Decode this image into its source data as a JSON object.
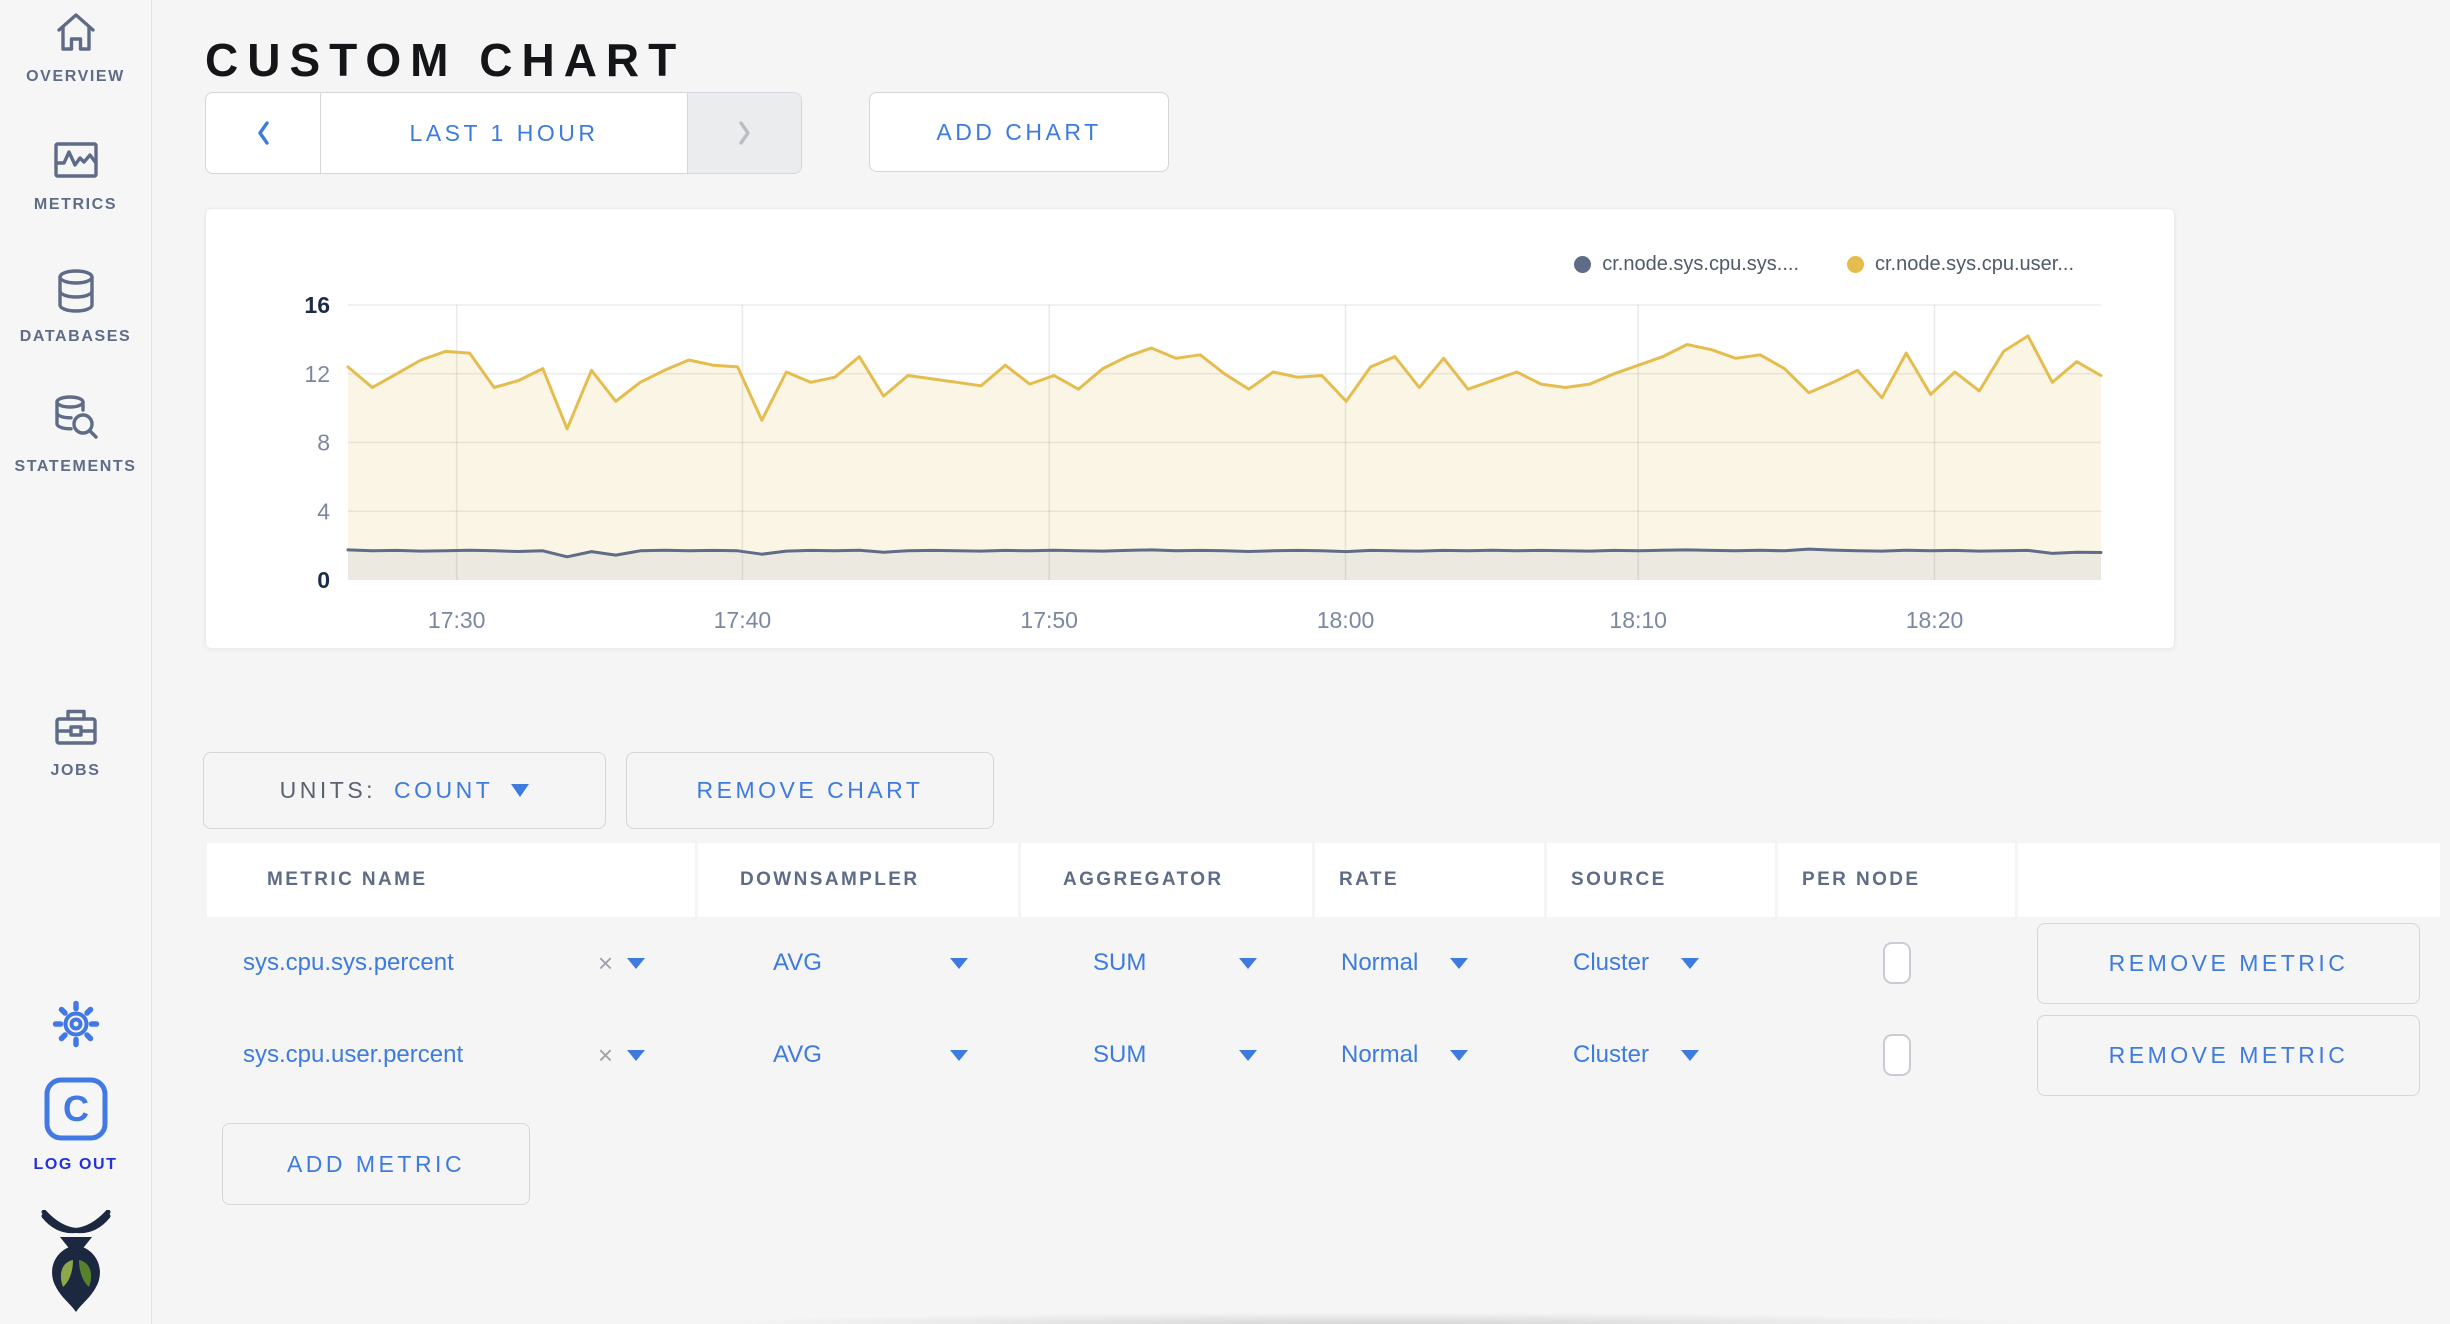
{
  "header": {
    "title": "CUSTOM CHART"
  },
  "sidebar": {
    "items": [
      {
        "label": "OVERVIEW",
        "icon": "home-icon"
      },
      {
        "label": "METRICS",
        "icon": "metrics-icon"
      },
      {
        "label": "DATABASES",
        "icon": "database-icon"
      },
      {
        "label": "STATEMENTS",
        "icon": "statements-icon"
      },
      {
        "label": "JOBS",
        "icon": "briefcase-icon"
      }
    ],
    "logout_label": "LOG OUT"
  },
  "controls": {
    "time_range_label": "LAST 1 HOUR",
    "add_chart_label": "ADD CHART"
  },
  "units": {
    "label": "UNITS:",
    "value": "COUNT"
  },
  "remove_chart_label": "REMOVE CHART",
  "add_metric_label": "ADD METRIC",
  "metrics_table": {
    "columns": [
      "METRIC NAME",
      "DOWNSAMPLER",
      "AGGREGATOR",
      "RATE",
      "SOURCE",
      "PER NODE",
      ""
    ],
    "clear_glyph": "×",
    "rows": [
      {
        "metric": "sys.cpu.sys.percent",
        "downsampler": "AVG",
        "aggregator": "SUM",
        "rate": "Normal",
        "source": "Cluster",
        "per_node": false,
        "remove_label": "REMOVE METRIC"
      },
      {
        "metric": "sys.cpu.user.percent",
        "downsampler": "AVG",
        "aggregator": "SUM",
        "rate": "Normal",
        "source": "Cluster",
        "per_node": false,
        "remove_label": "REMOVE METRIC"
      }
    ]
  },
  "chart_data": {
    "type": "line",
    "title": "",
    "xlabel": "",
    "ylabel": "",
    "ylim": [
      0,
      16
    ],
    "y_ticks": [
      0,
      4,
      8,
      12,
      16
    ],
    "grid": true,
    "legend_position": "top-right",
    "x_ticks": [
      {
        "label": "17:30",
        "frac": 0.062
      },
      {
        "label": "17:40",
        "frac": 0.225
      },
      {
        "label": "17:50",
        "frac": 0.4
      },
      {
        "label": "18:00",
        "frac": 0.569
      },
      {
        "label": "18:10",
        "frac": 0.736
      },
      {
        "label": "18:20",
        "frac": 0.905
      }
    ],
    "x_range_minutes": [
      "17:26",
      "18:26"
    ],
    "series": [
      {
        "name": "cr.node.sys.cpu.sys....",
        "color": "#5f6c87",
        "fill": "#ece9e0",
        "values": [
          1.75,
          1.7,
          1.72,
          1.68,
          1.7,
          1.73,
          1.7,
          1.66,
          1.7,
          1.35,
          1.65,
          1.45,
          1.7,
          1.73,
          1.7,
          1.72,
          1.7,
          1.5,
          1.68,
          1.72,
          1.7,
          1.73,
          1.62,
          1.7,
          1.72,
          1.7,
          1.68,
          1.72,
          1.7,
          1.73,
          1.7,
          1.68,
          1.72,
          1.75,
          1.7,
          1.72,
          1.7,
          1.66,
          1.7,
          1.72,
          1.7,
          1.65,
          1.72,
          1.7,
          1.68,
          1.72,
          1.7,
          1.73,
          1.7,
          1.72,
          1.7,
          1.68,
          1.72,
          1.7,
          1.73,
          1.75,
          1.72,
          1.7,
          1.73,
          1.7,
          1.8,
          1.74,
          1.7,
          1.68,
          1.73,
          1.7,
          1.72,
          1.68,
          1.7,
          1.72,
          1.55,
          1.62,
          1.6
        ]
      },
      {
        "name": "cr.node.sys.cpu.user...",
        "color": "#e5bd4f",
        "fill": "#faf5e5",
        "values": [
          12.4,
          11.2,
          12.0,
          12.8,
          13.3,
          13.2,
          11.2,
          11.6,
          12.3,
          8.8,
          12.2,
          10.4,
          11.5,
          12.2,
          12.8,
          12.5,
          12.4,
          9.3,
          12.1,
          11.5,
          11.8,
          13.0,
          10.7,
          11.9,
          11.7,
          11.5,
          11.3,
          12.5,
          11.4,
          11.9,
          11.1,
          12.3,
          13.0,
          13.5,
          12.9,
          13.1,
          12.0,
          11.1,
          12.1,
          11.8,
          11.9,
          10.4,
          12.4,
          13.0,
          11.2,
          12.9,
          11.1,
          11.6,
          12.1,
          11.4,
          11.2,
          11.4,
          12.0,
          12.5,
          13.0,
          13.7,
          13.4,
          12.9,
          13.1,
          12.3,
          10.9,
          11.5,
          12.2,
          10.6,
          13.2,
          10.8,
          12.1,
          11.0,
          13.3,
          14.2,
          11.5,
          12.7,
          11.9
        ]
      }
    ]
  },
  "colors": {
    "accent_blue": "#3e7bdf",
    "icon_slate": "#5f6c87",
    "logo_blue": "#4379e3",
    "logout_blue": "#2330e0",
    "axis_dark": "#1d2b4a",
    "axis_gray": "#7c88a1",
    "page_bg": "#f5f5f6"
  }
}
